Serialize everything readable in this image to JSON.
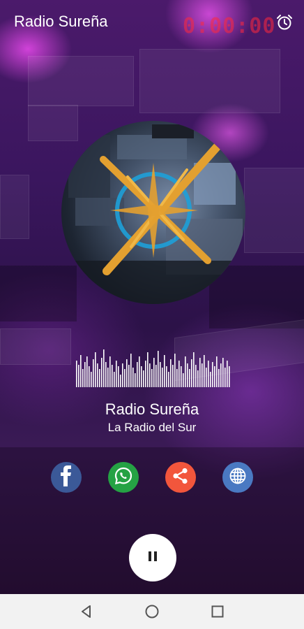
{
  "app": {
    "title": "Radio Sureña"
  },
  "background": {
    "studio_clock_text": "0:00:00"
  },
  "station": {
    "name": "Radio Sureña",
    "slogan": "La Radio del Sur"
  },
  "share": {
    "facebook_icon": "facebook-icon",
    "whatsapp_icon": "whatsapp-icon",
    "share_icon": "share-icon",
    "web_icon": "globe-icon"
  },
  "player": {
    "state": "playing",
    "control_icon": "pause-icon"
  },
  "colors": {
    "facebook": "#3b5998",
    "whatsapp": "#25a244",
    "share": "#f2563c",
    "web": "#4a79c2",
    "logo_accent": "#e3a030"
  },
  "android_nav": {
    "back": "back-icon",
    "home": "home-icon",
    "recents": "recents-icon"
  }
}
